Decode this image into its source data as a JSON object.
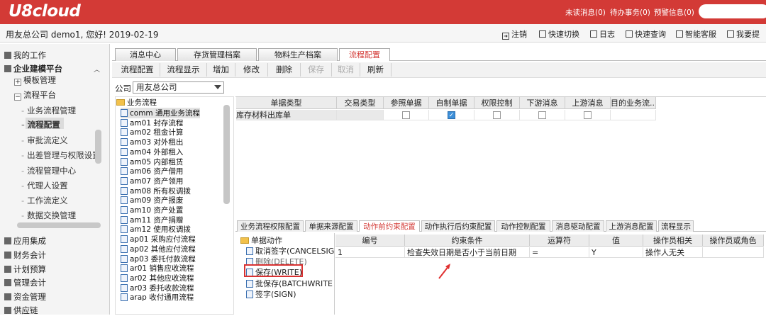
{
  "header": {
    "logo": "U8cloud",
    "links": [
      "未读消息(0)",
      "待办事务(0)",
      "预警信息(0)"
    ]
  },
  "userbar": {
    "greeting": "用友总公司 demo1, 您好! 2019-02-19",
    "actions": [
      "注销",
      "快速切换",
      "日志",
      "快速查询",
      "智能客服",
      "我要提"
    ]
  },
  "sidebar": {
    "sections": [
      "我的工作",
      "企业建模平台"
    ],
    "template": "模板管理",
    "flow_platform": "流程平台",
    "items": [
      "业务流程管理",
      "流程配置",
      "审批流定义",
      "出差管理与权限设置",
      "流程管理中心",
      "代理人设置",
      "工作流定义",
      "数据交换管理"
    ],
    "bottom": [
      "应用集成",
      "财务会计",
      "计划预算",
      "管理会计",
      "资金管理",
      "供应链"
    ]
  },
  "tabs": [
    "消息中心",
    "存货管理档案",
    "物料生产档案",
    "流程配置"
  ],
  "toolbar": {
    "buttons": [
      "流程配置",
      "流程显示",
      "增加",
      "修改",
      "删除",
      "保存",
      "取消",
      "刷新"
    ]
  },
  "company": {
    "label": "公司",
    "value": "用友总公司"
  },
  "tree": {
    "root": "业务流程",
    "items": [
      "comm 通用业务流程",
      "am01 封存流程",
      "am02 租金计算",
      "am03 对外租出",
      "am04 外部租入",
      "am05 内部租赁",
      "am06 资产借用",
      "am07 资产领用",
      "am08 所有权调拨",
      "am09 资产报废",
      "am10 资产处置",
      "am11 资产捐赠",
      "am12 使用权调拨",
      "ap01 采购应付流程",
      "ap02 其他应付流程",
      "ap03 委托付款流程",
      "ar01 销售应收流程",
      "ar02 其他应收流程",
      "ar03 委托收款流程",
      "arap 收付通用流程"
    ]
  },
  "grid": {
    "headers": [
      "单据类型",
      "交易类型",
      "参照单据",
      "自制单据",
      "权限控制",
      "下游消息",
      "上游消息",
      "目的业务流..."
    ],
    "row": {
      "doc_type": "库存材料出库单",
      "trade_type": "",
      "ref_doc": false,
      "self_doc": true,
      "perm": false,
      "down_msg": false,
      "up_msg": false
    }
  },
  "bottom_tabs": [
    "业务流程权限配置",
    "单据来源配置",
    "动作前约束配置",
    "动作执行后约束配置",
    "动作控制配置",
    "消息驱动配置",
    "上游消息配置",
    "流程显示"
  ],
  "actions": {
    "root": "单据动作",
    "items": [
      "取消签字(CANCELSIG",
      "删除(DELETE)",
      "保存(WRITE)",
      "批保存(BATCHWRITE",
      "签字(SIGN)"
    ]
  },
  "constraint_grid": {
    "headers": [
      "编号",
      "约束条件",
      "运算符",
      "值",
      "操作员相关",
      "操作员或角色"
    ],
    "row": [
      "1",
      "检查失效日期是否小于当前日期",
      "=",
      "Y",
      "操作人无关",
      ""
    ]
  }
}
